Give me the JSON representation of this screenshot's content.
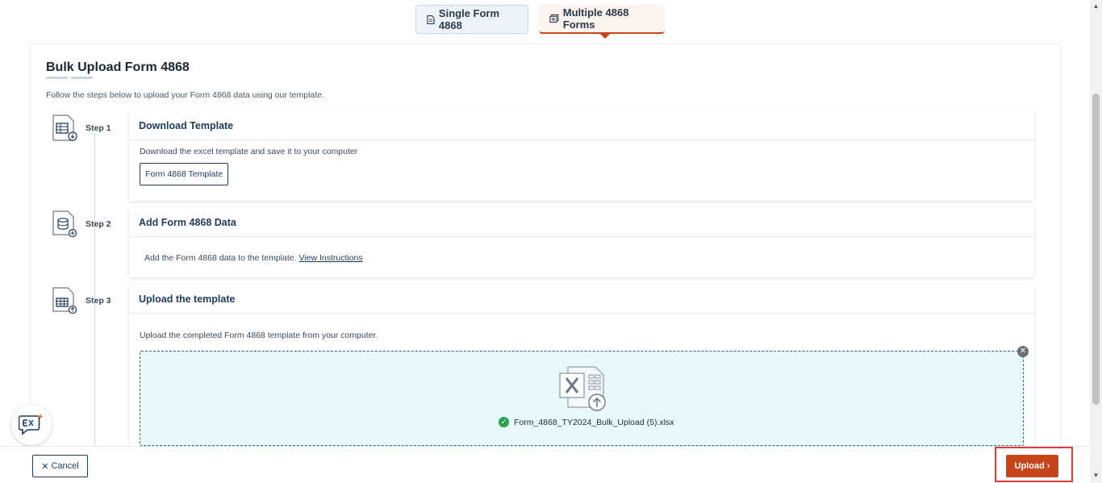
{
  "tabs": {
    "single": {
      "label": "Single Form 4868",
      "icon": "document-icon"
    },
    "multiple": {
      "label": "Multiple 4868 Forms",
      "icon": "multi-document-icon",
      "active": true
    }
  },
  "page": {
    "title": "Bulk Upload Form 4868",
    "subtitle": "Follow the steps below to upload your Form 4868 data using our template."
  },
  "steps": [
    {
      "label": "Step 1",
      "icon": "spreadsheet-download-icon",
      "title": "Download Template",
      "description": "Download the excel template and save it to your computer",
      "button_label": "Form 4868 Template"
    },
    {
      "label": "Step 2",
      "icon": "database-add-icon",
      "title": "Add Form 4868 Data",
      "description": "Add the Form 4868 data to the template.",
      "link_label": "View Instructions"
    },
    {
      "label": "Step 3",
      "icon": "spreadsheet-upload-icon",
      "title": "Upload the template",
      "description": "Upload the completed Form 4868 template from your computer.",
      "file_name": "Form_4868_TY2024_Bulk_Upload (5).xlsx"
    }
  ],
  "footer": {
    "cancel_label": "Cancel",
    "upload_label": "Upload"
  },
  "colors": {
    "accent": "#c8441a",
    "navy": "#1f3b5a",
    "dropzone_bg": "#e9f8fb",
    "success": "#2aa14f",
    "highlight": "#e03a3a"
  }
}
